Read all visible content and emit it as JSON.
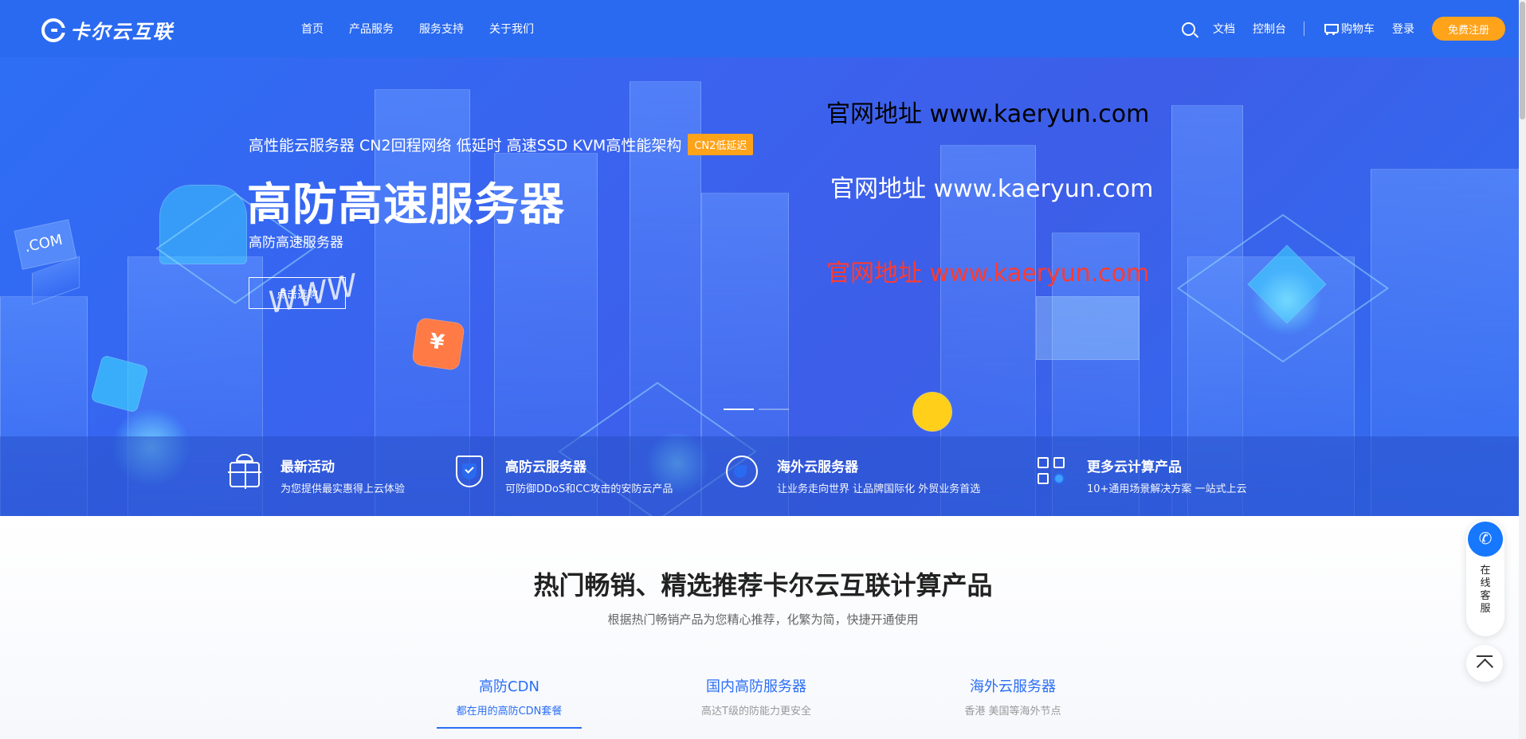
{
  "header": {
    "logo_text": "卡尔云互联",
    "nav": [
      "首页",
      "产品服务",
      "服务支持",
      "关于我们"
    ],
    "right": {
      "docs": "文档",
      "console": "控制台",
      "cart": "购物车",
      "login": "登录",
      "register": "免费注册"
    }
  },
  "hero": {
    "tagline": "高性能云服务器 CN2回程网络 低延时 高速SSD KVM高性能架构",
    "badge": "CN2低延迟",
    "title": "高防高速服务器",
    "subtitle": "高防高速服务器",
    "button": "点击选购",
    "site_texts": [
      "官网地址 www.kaeryun.com",
      "官网地址 www.kaeryun.com",
      "官网地址 www.kaeryun.com"
    ],
    "decor_labels": [
      ".COM",
      "WWW",
      "¥"
    ],
    "slides": 2,
    "active_slide": 1
  },
  "features": [
    {
      "icon": "gift-icon",
      "title": "最新活动",
      "desc": "为您提供最实惠得上云体验"
    },
    {
      "icon": "shield-icon",
      "title": "高防云服务器",
      "desc": "可防御DDoS和CC攻击的安防云产品"
    },
    {
      "icon": "globe-icon",
      "title": "海外云服务器",
      "desc": "让业务走向世界 让品牌国际化 外贸业务首选"
    },
    {
      "icon": "grid-icon",
      "title": "更多云计算产品",
      "desc": "10+通用场景解决方案 一站式上云"
    }
  ],
  "products": {
    "title": "热门畅销、精选推荐卡尔云互联计算产品",
    "subtitle": "根据热门畅销产品为您精心推荐，化繁为简，快捷开通使用",
    "tabs": [
      {
        "label": "高防CDN",
        "desc": "都在用的高防CDN套餐",
        "active": true
      },
      {
        "label": "国内高防服务器",
        "desc": "高达T级的防能力更安全",
        "active": false
      },
      {
        "label": "海外云服务器",
        "desc": "香港 美国等海外节点",
        "active": false
      }
    ]
  },
  "float": {
    "service": "在线客服"
  },
  "colors": {
    "brand": "#2a6af0",
    "accent": "#ffa31a",
    "link": "#2b6ef5",
    "watermark_red": "#ff3b30"
  }
}
